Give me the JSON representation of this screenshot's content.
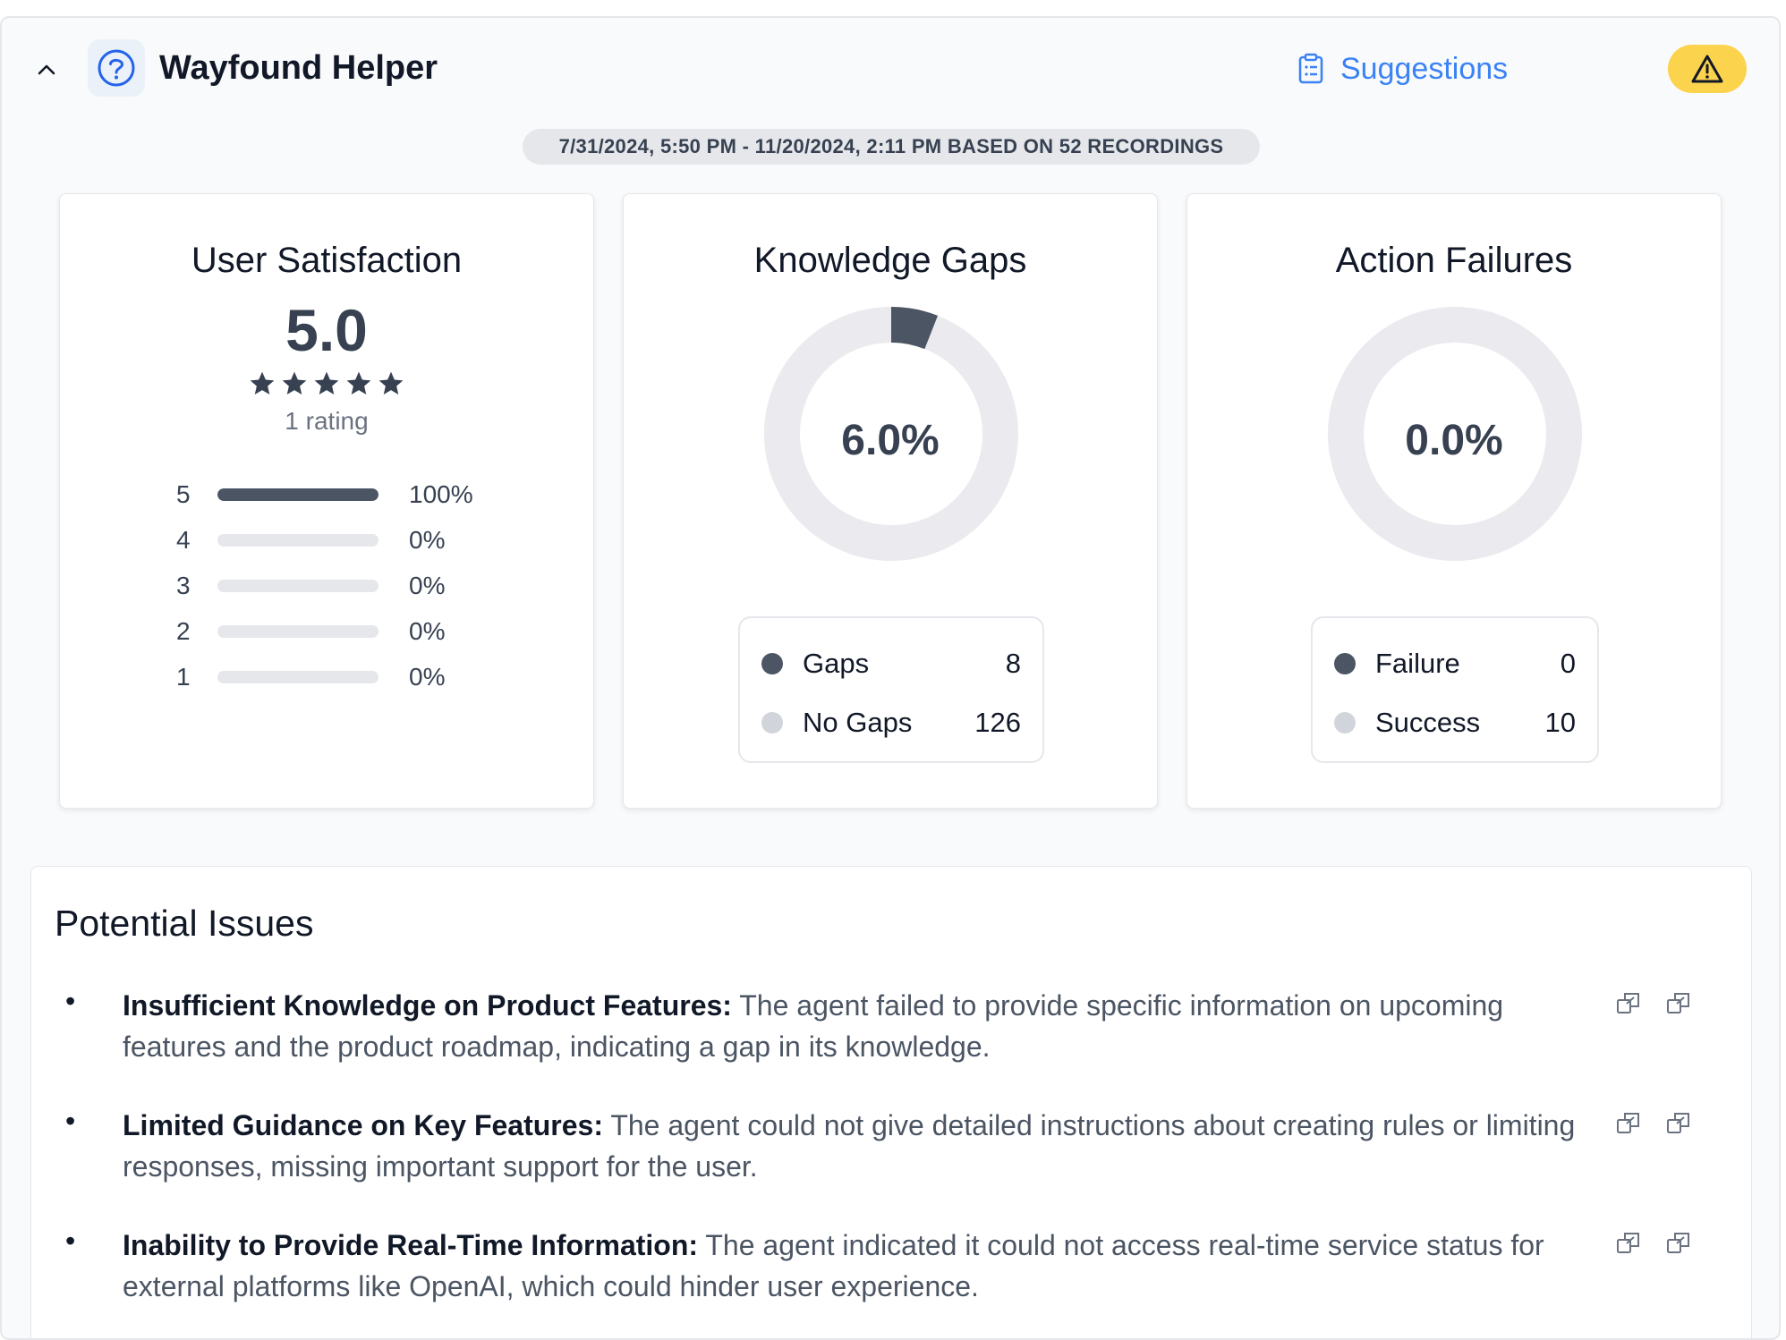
{
  "header": {
    "title": "Wayfound Helper",
    "suggestions_label": "Suggestions",
    "date_range": "7/31/2024, 5:50 PM - 11/20/2024, 2:11 PM BASED ON 52 RECORDINGS"
  },
  "colors": {
    "accent": "#3b82f6",
    "warning": "#fcd34d",
    "dark": "#4b5563",
    "light": "#e5e7eb"
  },
  "user_satisfaction": {
    "title": "User Satisfaction",
    "score": "5.0",
    "stars": 5,
    "rating_count": "1 rating",
    "rows": [
      {
        "star": "5",
        "fraction": 1.0,
        "pct": "100%"
      },
      {
        "star": "4",
        "fraction": 0.0,
        "pct": "0%"
      },
      {
        "star": "3",
        "fraction": 0.0,
        "pct": "0%"
      },
      {
        "star": "2",
        "fraction": 0.0,
        "pct": "0%"
      },
      {
        "star": "1",
        "fraction": 0.0,
        "pct": "0%"
      }
    ]
  },
  "knowledge_gaps": {
    "title": "Knowledge Gaps",
    "percent_label": "6.0%",
    "legend": [
      {
        "label": "Gaps",
        "value": "8",
        "color": "#4b5563"
      },
      {
        "label": "No Gaps",
        "value": "126",
        "color": "#d1d5db"
      }
    ]
  },
  "action_failures": {
    "title": "Action Failures",
    "percent_label": "0.0%",
    "legend": [
      {
        "label": "Failure",
        "value": "0",
        "color": "#4b5563"
      },
      {
        "label": "Success",
        "value": "10",
        "color": "#d1d5db"
      }
    ]
  },
  "issues": {
    "title": "Potential Issues",
    "items": [
      {
        "heading": "Insufficient Knowledge on Product Features:",
        "text": " The agent failed to provide specific information on upcoming features and the product roadmap, indicating a gap in its knowledge."
      },
      {
        "heading": "Limited Guidance on Key Features:",
        "text": " The agent could not give detailed instructions about creating rules or limiting responses, missing important support for the user."
      },
      {
        "heading": "Inability to Provide Real-Time Information:",
        "text": " The agent indicated it could not access real-time service status for external platforms like OpenAI, which could hinder user experience."
      }
    ]
  },
  "icons": {
    "collapse": "chevron-up-icon",
    "app": "question-circle-icon",
    "suggestions": "clipboard-list-icon",
    "warning": "warning-triangle-icon",
    "issue_action_1": "open-in-window-icon",
    "issue_action_2": "open-in-window-icon"
  }
}
